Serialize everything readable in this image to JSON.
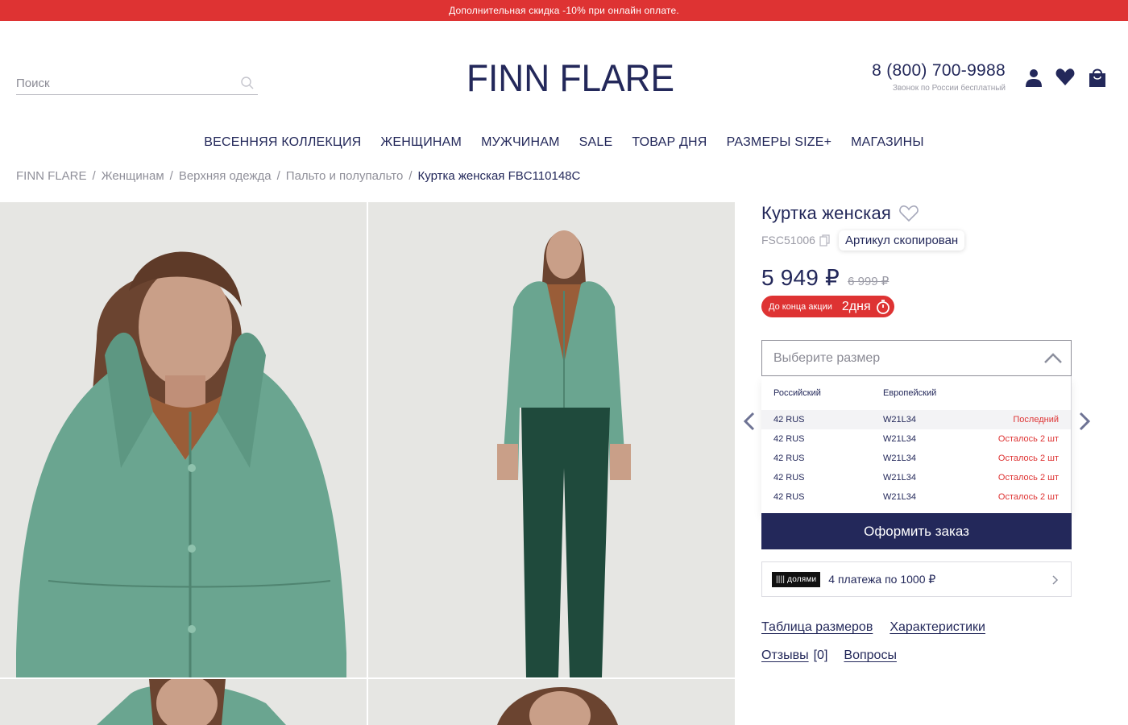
{
  "promo_banner": "Дополнительная скидка -10% при онлайн оплате.",
  "header": {
    "search_placeholder": "Поиск",
    "logo_text": "FINN FLARE",
    "phone": "8 (800) 700-9988",
    "phone_note": "Звонок по России бесплатный",
    "icons": [
      "account-icon",
      "heart-icon",
      "cart-icon"
    ]
  },
  "nav": [
    "ВЕСЕННЯЯ КОЛЛЕКЦИЯ",
    "ЖЕНЩИНАМ",
    "МУЖЧИНАМ",
    "SALE",
    "ТОВАР ДНЯ",
    "РАЗМЕРЫ SIZE+",
    "МАГАЗИНЫ"
  ],
  "breadcrumb": {
    "items": [
      "FINN FLARE",
      "Женщинам",
      "Верхняя одежда",
      "Пальто и полупальто"
    ],
    "separator": "/",
    "current": "Куртка женская FBC110148C"
  },
  "product": {
    "title": "Куртка женская",
    "sku": "FSC51006",
    "sku_toast": "Артикул скопирован",
    "price": "5 949 ₽",
    "old_price": "6 999 ₽",
    "promo_label": "До конца акции",
    "promo_time": "2дня",
    "size_placeholder": "Выберите размер",
    "size_table": {
      "headers": [
        "Российский",
        "Европейский"
      ],
      "rows": [
        {
          "ru": "42 RUS",
          "eu": "W21L34",
          "stock": "Последний"
        },
        {
          "ru": "42 RUS",
          "eu": "W21L34",
          "stock": "Осталось 2 шт"
        },
        {
          "ru": "42 RUS",
          "eu": "W21L34",
          "stock": "Осталось 2 шт"
        },
        {
          "ru": "42 RUS",
          "eu": "W21L34",
          "stock": "Осталось 2 шт"
        },
        {
          "ru": "42 RUS",
          "eu": "W21L34",
          "stock": "Осталось 2 шт"
        }
      ]
    },
    "order_button": "Оформить заказ",
    "installment_logo": "|||| долями",
    "installment_text": "4 платежа по 1000 ₽",
    "links": {
      "size_chart": "Таблица размеров",
      "specs": "Характеристики",
      "reviews": "Отзывы",
      "reviews_count": "[0]",
      "questions": "Вопросы"
    }
  },
  "colors": {
    "brand_navy": "#23285a",
    "accent_red": "#de3333",
    "jacket_green": "#6aa590"
  }
}
